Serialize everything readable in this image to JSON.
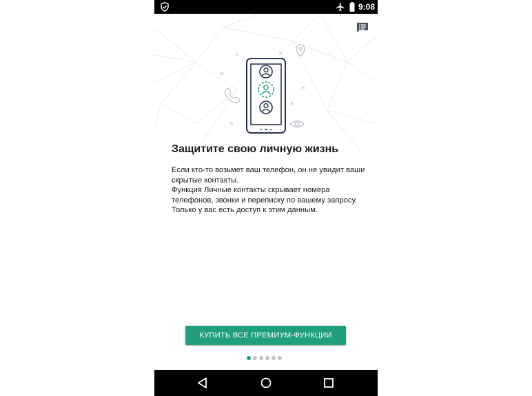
{
  "status_bar": {
    "time": "9:08",
    "left_icon": "shield-check-icon",
    "right_icons": [
      "airplane-icon",
      "battery-icon"
    ]
  },
  "header": {
    "action_icon": "message-list-icon"
  },
  "illustration": {
    "icon": "phone-contacts-illustration"
  },
  "content": {
    "title": "Защитите свою личную жизнь",
    "description_lines": [
      "Если кто-то возьмет ваш телефон, он не увидит ваши скрытые контакты.",
      "Функция Личные контакты скрывает номера телефонов, звонки и переписку по вашему запросу.",
      "Только у вас есть доступ к этим данным."
    ]
  },
  "primary_button": {
    "label": "КУПИТЬ ВСЕ ПРЕМИУМ-ФУНКЦИИ"
  },
  "pager": {
    "total": 6,
    "active_index": 0
  },
  "nav_bar": {
    "buttons": [
      "back-icon",
      "home-icon",
      "recents-icon"
    ]
  },
  "colors": {
    "accent": "#1f9e80",
    "illustration_stroke": "#2b3450",
    "dot_inactive": "#c4c4c4",
    "bars": "#000000"
  }
}
